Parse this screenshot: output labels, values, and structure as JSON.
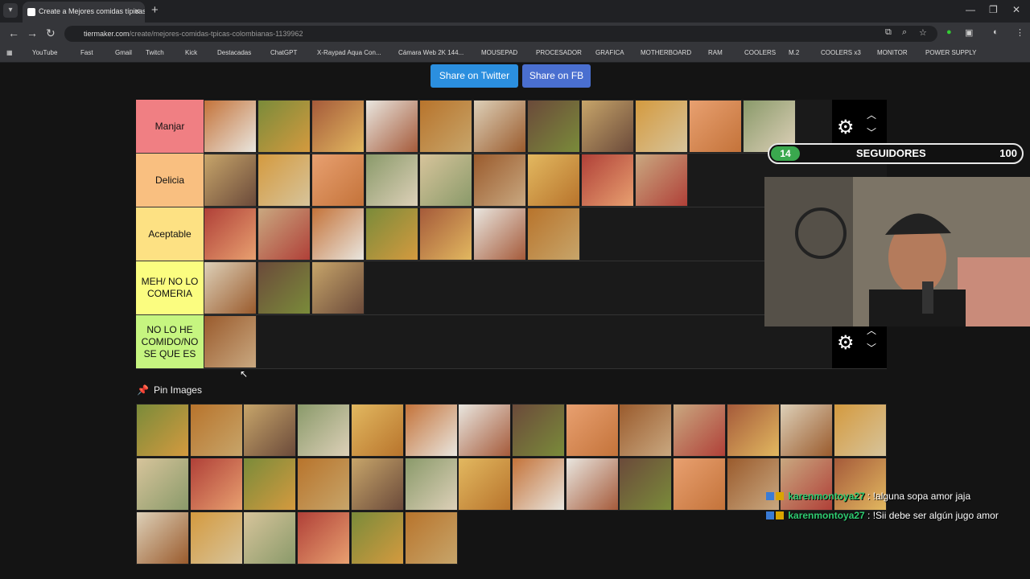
{
  "browser": {
    "tab_title": "Create a Mejores comidas típicas...",
    "url_host": "tiermaker.com",
    "url_path": "/create/mejores-comidas-tpicas-colombianas-1139962",
    "bookmarks": [
      "YouTube",
      "Fast",
      "Gmail",
      "Twitch",
      "Kick",
      "Destacadas",
      "ChatGPT",
      "X-Raypad Aqua Con...",
      "Cámara Web 2K 144...",
      "MOUSEPAD",
      "PROCESADOR",
      "GRAFICA",
      "MOTHERBOARD",
      "RAM",
      "COOLERS",
      "M.2",
      "COOLERS x3",
      "MONITOR",
      "POWER SUPPLY"
    ]
  },
  "share": {
    "twitter": "Share on Twitter",
    "fb": "Share on FB"
  },
  "tiers": [
    {
      "label": "Manjar",
      "color": "#f07f83",
      "count": 11
    },
    {
      "label": "Delicia",
      "color": "#f9bf80",
      "count": 9
    },
    {
      "label": "Aceptable",
      "color": "#fde183",
      "count": 7
    },
    {
      "label": "MEH/ NO LO COMERIA",
      "color": "#fbfd80",
      "count": 3
    },
    {
      "label": "NO LO HE COMIDO/NO SE QUE ES",
      "color": "#c6f580",
      "count": 1
    }
  ],
  "pin_images": {
    "label": "Pin Images",
    "count": 34
  },
  "overlay": {
    "followers_current": "14",
    "followers_label": "SEGUIDORES",
    "followers_goal": "100",
    "chat": [
      {
        "user": "karenmontoya27",
        "msg": " : !alguna sopa amor jaja"
      },
      {
        "user": "karenmontoya27",
        "msg": " : !Sii debe ser algún jugo amor"
      }
    ]
  },
  "colors": {
    "accent_twitter": "#2b8fdf",
    "accent_fb": "#4a6fd0",
    "page_bg": "#141414"
  }
}
